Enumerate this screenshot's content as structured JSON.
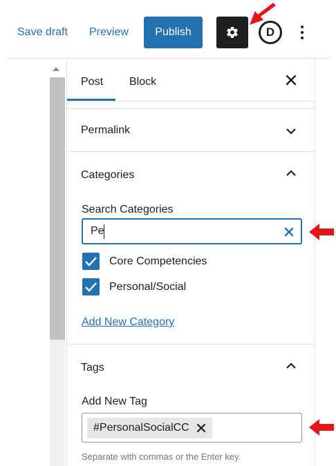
{
  "toolbar": {
    "save_draft": "Save draft",
    "preview": "Preview",
    "publish": "Publish",
    "divi_letter": "D",
    "settings_icon": "gear-icon",
    "more_icon": "vertical-ellipsis-icon"
  },
  "sidebar": {
    "tabs": [
      {
        "label": "Post",
        "active": true
      },
      {
        "label": "Block",
        "active": false
      }
    ],
    "close_icon": "close-icon",
    "permalink": {
      "title": "Permalink",
      "expanded": false
    },
    "categories": {
      "title": "Categories",
      "expanded": true,
      "search_label": "Search Categories",
      "search_value": "Pe",
      "items": [
        {
          "label": "Core Competencies",
          "checked": true
        },
        {
          "label": "Personal/Social",
          "checked": true
        }
      ],
      "add_new_link": "Add New Category"
    },
    "tags": {
      "title": "Tags",
      "expanded": true,
      "add_label": "Add New Tag",
      "chips": [
        "#PersonalSocialCC"
      ],
      "help_text": "Separate with commas or the Enter key."
    }
  },
  "colors": {
    "accent": "#2271b1",
    "dark": "#1e1e1e",
    "annotation": "#e5141b",
    "border": "#e0e0e0"
  }
}
